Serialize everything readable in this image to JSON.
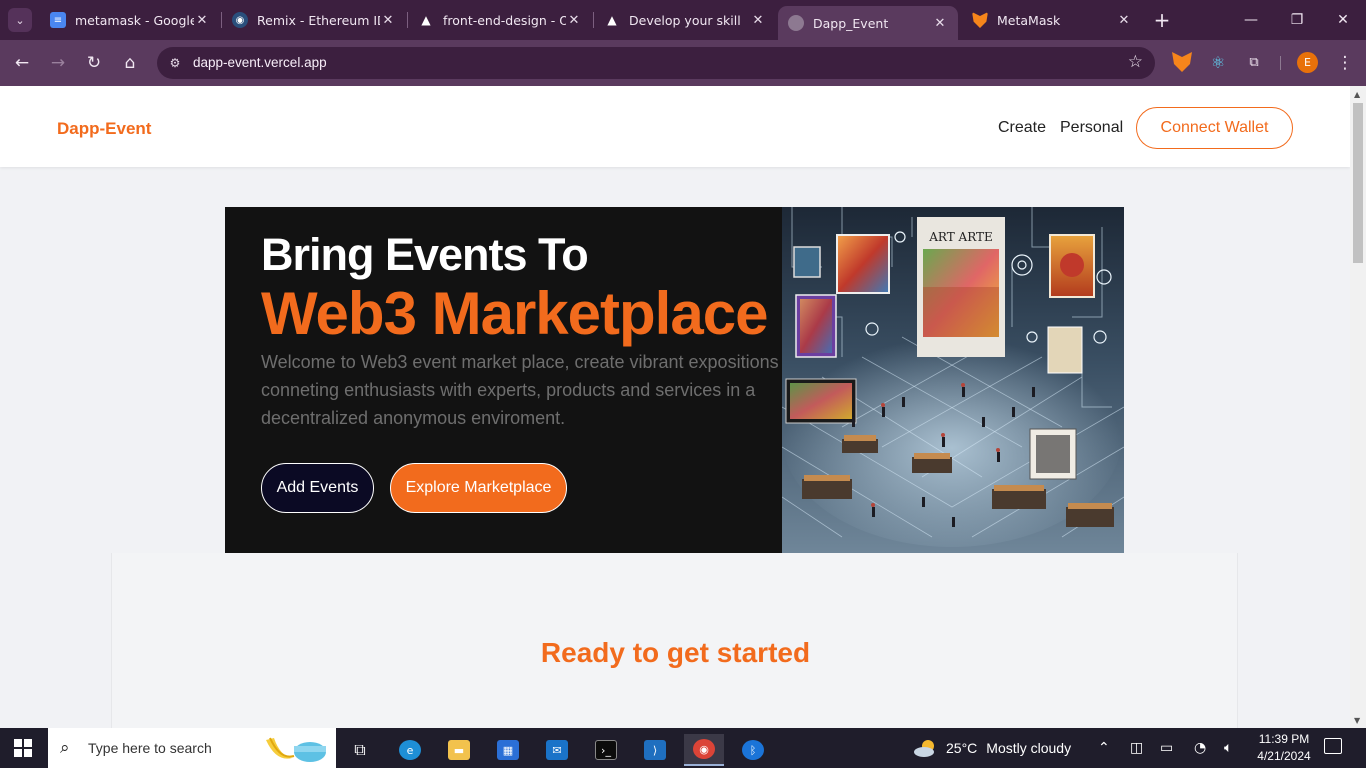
{
  "browser": {
    "tabs": [
      {
        "title": "metamask - Google Docs",
        "icon": "google-docs-icon"
      },
      {
        "title": "Remix - Ethereum IDE",
        "icon": "remix-icon"
      },
      {
        "title": "front-end-design - Overview",
        "icon": "triangle-icon"
      },
      {
        "title": "Develop your skill",
        "icon": "triangle-icon"
      },
      {
        "title": "Dapp_Event",
        "icon": "globe-icon"
      },
      {
        "title": "MetaMask",
        "icon": "metamask-fox-icon"
      }
    ],
    "active_tab_index": 4,
    "url": "dapp-event.vercel.app",
    "profile_initial": "E"
  },
  "site": {
    "brand": "Dapp-Event",
    "nav": {
      "create": "Create",
      "personal": "Personal"
    },
    "connect_wallet": "Connect Wallet"
  },
  "hero": {
    "title_line1": "Bring Events To",
    "title_line2": "Web3 Marketplace",
    "description": "Welcome to Web3 event market place, create vibrant expositions conneting enthusiasts with experts, products and services in a decentralized anonymous enviroment.",
    "add_button": "Add Events",
    "explore_button": "Explore Marketplace",
    "image_caption": "ART ARTE",
    "image_alt": "isometric digital art marketplace illustration"
  },
  "section": {
    "heading": "Ready to get started"
  },
  "taskbar": {
    "search_placeholder": "Type here to search",
    "weather": {
      "temp": "25°C",
      "condition": "Mostly cloudy"
    },
    "time": "11:39 PM",
    "date": "4/21/2024"
  },
  "colors": {
    "accent": "#f26b1d",
    "dark": "#121212",
    "chrome": "#3c1f3f"
  }
}
